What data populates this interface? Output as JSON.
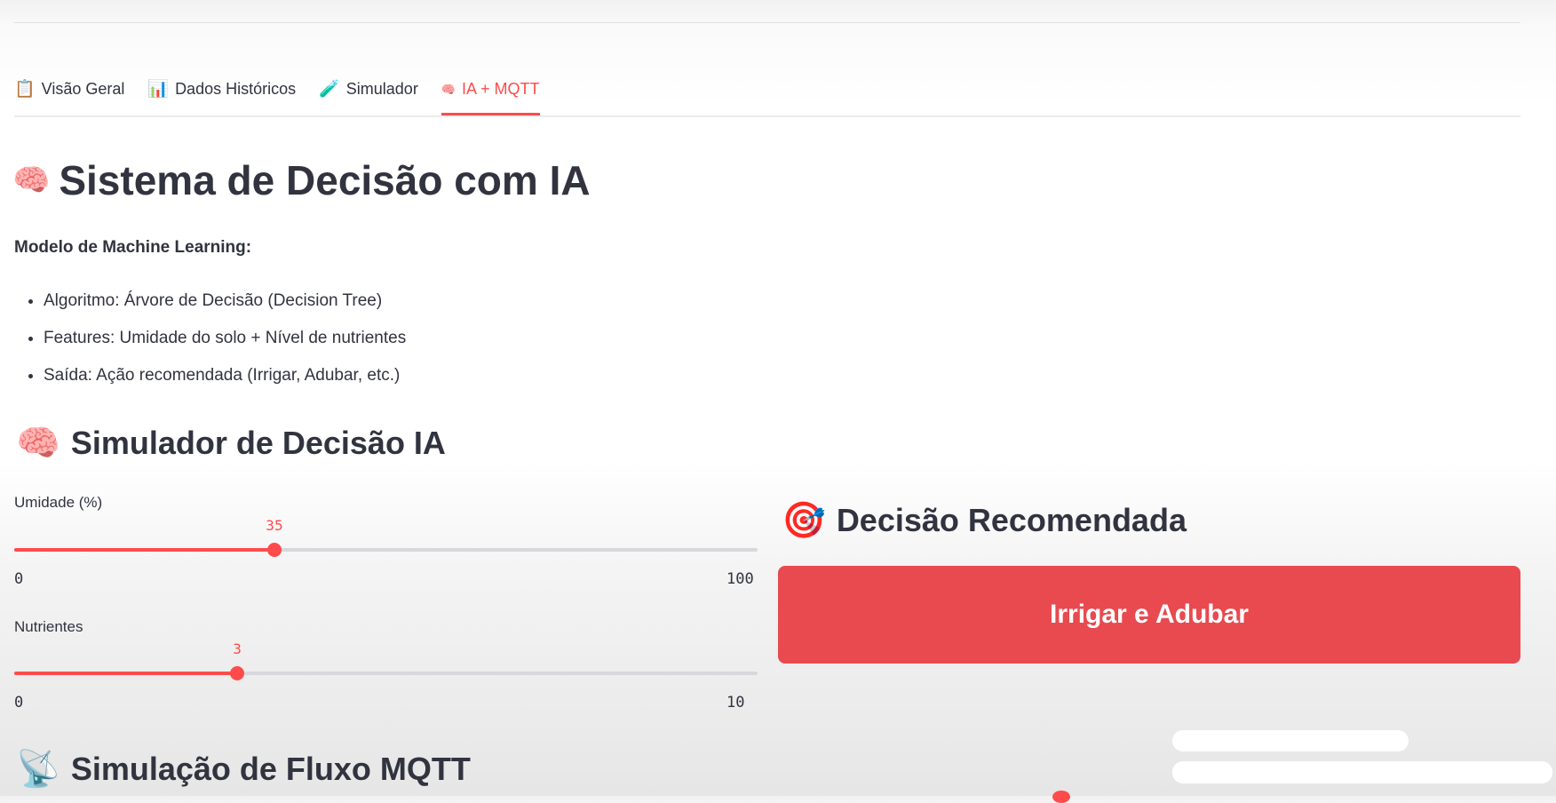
{
  "tabs": [
    {
      "icon": "📋",
      "label": "Visão Geral",
      "active": false
    },
    {
      "icon": "📊",
      "label": "Dados Históricos",
      "active": false
    },
    {
      "icon": "🧪",
      "label": "Simulador",
      "active": false
    },
    {
      "icon": "🧠",
      "label": "IA + MQTT",
      "active": true
    }
  ],
  "page": {
    "title_icon": "🧠",
    "title": "Sistema de Decisão com IA",
    "model_label": "Modelo de Machine Learning:",
    "bullets": [
      "Algoritmo: Árvore de Decisão (Decision Tree)",
      "Features: Umidade do solo + Nível de nutrientes",
      "Saída: Ação recomendada (Irrigar, Adubar, etc.)"
    ]
  },
  "simulator": {
    "icon": "🧠",
    "title": "Simulador de Decisão IA",
    "sliders": [
      {
        "label": "Umidade (%)",
        "value": "35",
        "min": "0",
        "max": "100"
      },
      {
        "label": "Nutrientes",
        "value": "3",
        "min": "0",
        "max": "10"
      }
    ]
  },
  "decision": {
    "icon": "🎯",
    "title": "Decisão Recomendada",
    "result": "Irrigar e Adubar"
  },
  "mqtt": {
    "icon": "📡",
    "title": "Simulação de Fluxo MQTT"
  },
  "colors": {
    "accent": "#ff4b4b",
    "decision_bg": "#e84a4f",
    "text": "#31333f"
  }
}
